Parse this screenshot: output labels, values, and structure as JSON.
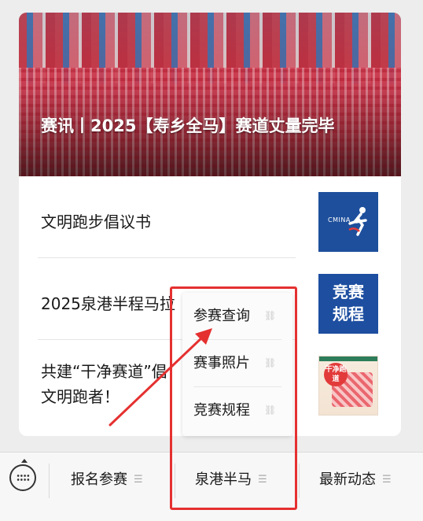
{
  "articles": {
    "hero": {
      "title": "赛讯丨2025【寿乡全马】赛道丈量完毕"
    },
    "items": [
      {
        "title": "文明跑步倡议书",
        "thumb_text": "CMINA"
      },
      {
        "title": "2025泉港半程马拉",
        "thumb_text_line1": "竞赛",
        "thumb_text_line2": "规程"
      },
      {
        "title_line1": "共建“干净赛道”倡",
        "title_line2": "文明跑者！",
        "thumb_badge": "干净跑道"
      }
    ]
  },
  "submenu": {
    "items": [
      {
        "label": "参赛查询",
        "icon": "link-icon"
      },
      {
        "label": "赛事照片",
        "icon": "link-icon"
      },
      {
        "label": "竞赛规程",
        "icon": "link-icon"
      }
    ]
  },
  "tabbar": {
    "keyboard_icon": "keyboard-icon",
    "tabs": [
      {
        "label": "报名参赛",
        "icon": "menu-icon"
      },
      {
        "label": "泉港半马",
        "icon": "menu-icon"
      },
      {
        "label": "最新动态",
        "icon": "menu-icon"
      }
    ]
  },
  "colors": {
    "annotation": "#e53030",
    "thumb_blue": "#1e4f9c",
    "page_bg": "#ededed"
  }
}
